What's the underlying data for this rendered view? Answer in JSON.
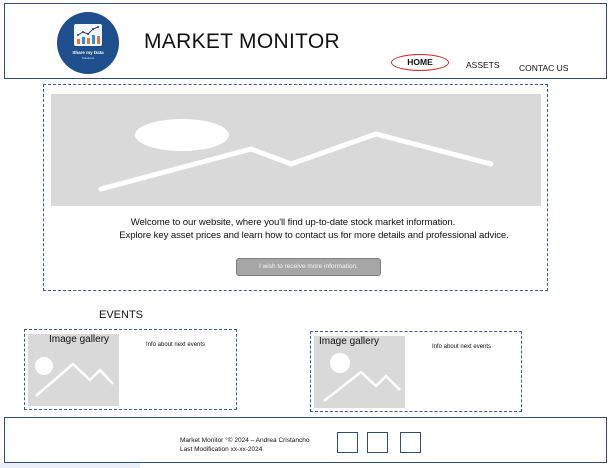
{
  "header": {
    "logo": {
      "line1": "Share my Data",
      "line2": "Solutions",
      "icon": "bar-chart-logo-icon",
      "colors": {
        "circle": "#1f4e8c",
        "bars": [
          "#e8742e",
          "#2f8fd8",
          "#e8742e",
          "#2f8fd8",
          "#e8742e"
        ]
      }
    },
    "title": "MARKET MONITOR",
    "nav": {
      "home": "HOME",
      "assets": "ASSETS",
      "contact": "CONTAC US"
    },
    "active_nav_color": "#e0211f"
  },
  "hero": {
    "image_icon": "image-placeholder-icon",
    "line1": "Welcome to our website, where you'll find up-to-date stock market information.",
    "line2": "Explore key asset prices and learn how to contact us for more details and professional advice.",
    "cta_label": "I wish to receive more information."
  },
  "events": {
    "title": "EVENTS",
    "cards": [
      {
        "gallery_label": "Image gallery",
        "info": "Info about next events",
        "image_icon": "image-placeholder-icon"
      },
      {
        "gallery_label": "Image gallery",
        "info": "Info about next events",
        "image_icon": "image-placeholder-icon"
      }
    ]
  },
  "footer": {
    "copyright": "Market Monitor °© 2024 – Andrea Cristancho",
    "last_modification": "Last Modification xx-xx-2024",
    "social_icons": [
      "social-box-icon",
      "social-box-icon",
      "social-box-icon"
    ]
  },
  "colors": {
    "border": "#2f4b86",
    "dashed": "#3c5a92",
    "placeholder": "#d9d9d9",
    "button": "#a6a6a6"
  }
}
